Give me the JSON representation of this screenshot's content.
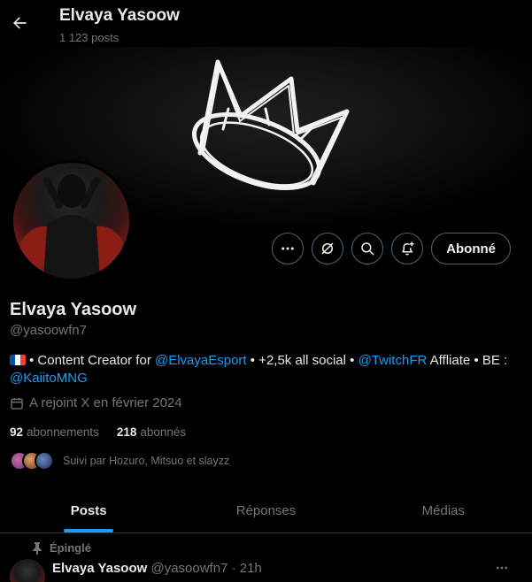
{
  "header": {
    "title": "Elvaya Yasoow",
    "post_count": "1 123 posts"
  },
  "profile": {
    "name": "Elvaya Yasoow",
    "handle": "@yasoowfn7",
    "bio": {
      "part1": "• Content Creator for ",
      "link1": "@ElvayaEsport",
      "part2": " • +2,5k all social • ",
      "link2": "@TwitchFR",
      "part3": " Affliate • BE : ",
      "link3": "@KaiitoMNG"
    },
    "joined": "A rejoint X en février 2024",
    "following_count": "92",
    "following_label": "abonnements",
    "followers_count": "218",
    "followers_label": "abonnés",
    "followed_by": "Suivi par Hozuro, Mitsuo et slayzz"
  },
  "actions": {
    "follow_label": "Abonné"
  },
  "tabs": [
    {
      "label": "Posts",
      "active": true
    },
    {
      "label": "Réponses",
      "active": false
    },
    {
      "label": "Médias",
      "active": false
    }
  ],
  "pinned_tweet": {
    "pinned_label": "Épinglé",
    "name": "Elvaya Yasoow",
    "meta": "@yasoowfn7 · 21h"
  },
  "colors": {
    "background": "#000000",
    "accent": "#1d9bf0",
    "text": "#e7e9ea",
    "muted": "#71767b"
  }
}
